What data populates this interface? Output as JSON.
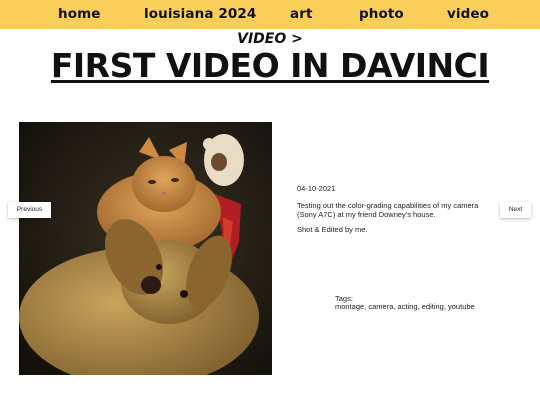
{
  "nav": {
    "items": [
      {
        "label": "home"
      },
      {
        "label": "louisiana 2024"
      },
      {
        "label": "art"
      },
      {
        "label": "photo"
      },
      {
        "label": "video"
      }
    ],
    "bg_color": "#f9cf59"
  },
  "breadcrumb": "VIDEO >",
  "title": "FIRST VIDEO IN DAVINCI",
  "post": {
    "date": "04-10-2021",
    "description": "Testing out the color-grading capabilities of my camera (Sony A7C) at my friend Downey's house.",
    "credit": "Shot & Edited by me.",
    "tags_label": "Tags:",
    "tags": [
      "montage",
      "camera",
      "acting",
      "editing",
      "youtube"
    ]
  },
  "pagination": {
    "previous": "Previous",
    "next": "Next"
  },
  "media": {
    "icon": "video-thumbnail"
  }
}
